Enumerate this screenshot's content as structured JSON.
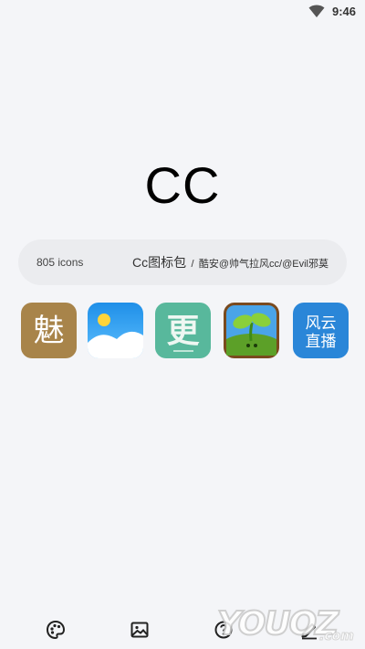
{
  "status_bar": {
    "time": "9:46",
    "wifi_icon": "wifi-icon"
  },
  "title": "CC",
  "info_card": {
    "icon_count": "805 icons",
    "pack_name": "Cc图标包",
    "separator": "/",
    "author": "酷安@帅气拉风cc/@Evil邪莫"
  },
  "preview_icons": [
    {
      "icon": "mei-character-icon",
      "text": "魅",
      "color": "#a8844a"
    },
    {
      "icon": "gallery-landscape-icon",
      "color": "#2f9ef0"
    },
    {
      "icon": "geng-character-icon",
      "text": "更",
      "color": "#58b89c"
    },
    {
      "icon": "sprout-game-icon",
      "color": "#6ab030"
    },
    {
      "icon": "fengyun-live-icon",
      "text": [
        "风云",
        "直播"
      ],
      "color": "#2a86d8"
    }
  ],
  "bottom_nav": [
    {
      "icon": "palette-icon"
    },
    {
      "icon": "image-icon"
    },
    {
      "icon": "help-icon"
    },
    {
      "icon": "edit-icon"
    }
  ],
  "watermark": {
    "text": "YOUOZ",
    "domain": ".com"
  }
}
